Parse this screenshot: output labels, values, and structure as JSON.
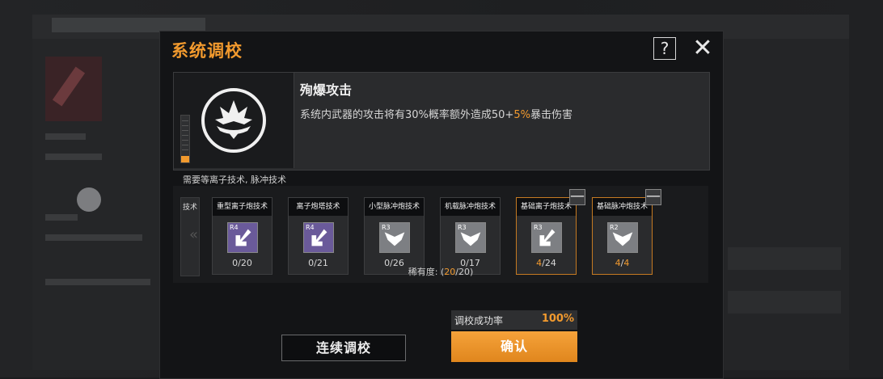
{
  "modal": {
    "title": "系统调校",
    "help_label": "?",
    "close_label": "✕"
  },
  "skill": {
    "name": "殉爆攻击",
    "desc_before": "系统内武器的攻击将有30%概率额外造成50+",
    "desc_highlight": "5%",
    "desc_after": "暴击伤害"
  },
  "requirement": "需要等离子技术, 脉冲技术",
  "partial_slot_name": "技术",
  "slots": [
    {
      "name": "重型离子炮技术",
      "rank": "R4",
      "count_have": "0",
      "count_sep": "/",
      "count_total": "20"
    },
    {
      "name": "离子炮塔技术",
      "rank": "R4",
      "count_have": "0",
      "count_sep": "/",
      "count_total": "21"
    },
    {
      "name": "小型脉冲炮技术",
      "rank": "R3",
      "count_have": "0",
      "count_sep": "/",
      "count_total": "26"
    },
    {
      "name": "机载脉冲炮技术",
      "rank": "R3",
      "count_have": "0",
      "count_sep": "/",
      "count_total": "17"
    },
    {
      "name": "基础离子炮技术",
      "rank": "R3",
      "count_have": "4",
      "count_sep": "/",
      "count_total": "24"
    },
    {
      "name": "基础脉冲炮技术",
      "rank": "R2",
      "count_have": "4",
      "count_sep": "/",
      "count_total": "4"
    }
  ],
  "minus_label": "—",
  "rarity": {
    "label": "稀有度: (",
    "value": "20",
    "total": "/20)"
  },
  "rate": {
    "label": "调校成功率",
    "value": "100%"
  },
  "buttons": {
    "continuous": "连续调校",
    "confirm": "确认"
  },
  "colors": {
    "accent": "#f29a2e",
    "panel": "#2a2b2d",
    "purple_icon": "#6a5a9a",
    "grey_icon": "#7d7f83"
  }
}
